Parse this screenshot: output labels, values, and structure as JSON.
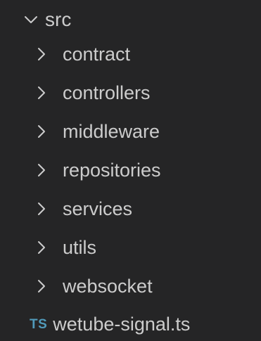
{
  "explorer": {
    "root": {
      "label": "src",
      "expanded": true,
      "chevron_icon": "chevron-down-icon"
    },
    "folders": [
      {
        "label": "contract",
        "expanded": false,
        "chevron_icon": "chevron-right-icon"
      },
      {
        "label": "controllers",
        "expanded": false,
        "chevron_icon": "chevron-right-icon"
      },
      {
        "label": "middleware",
        "expanded": false,
        "chevron_icon": "chevron-right-icon"
      },
      {
        "label": "repositories",
        "expanded": false,
        "chevron_icon": "chevron-right-icon"
      },
      {
        "label": "services",
        "expanded": false,
        "chevron_icon": "chevron-right-icon"
      },
      {
        "label": "utils",
        "expanded": false,
        "chevron_icon": "chevron-right-icon"
      },
      {
        "label": "websocket",
        "expanded": false,
        "chevron_icon": "chevron-right-icon"
      }
    ],
    "files": [
      {
        "label": "wetube-signal.ts",
        "badge": "TS",
        "icon": "typescript-file-icon"
      }
    ]
  },
  "colors": {
    "background": "#252526",
    "text": "#cccccc",
    "typescript_badge": "#519aba"
  }
}
